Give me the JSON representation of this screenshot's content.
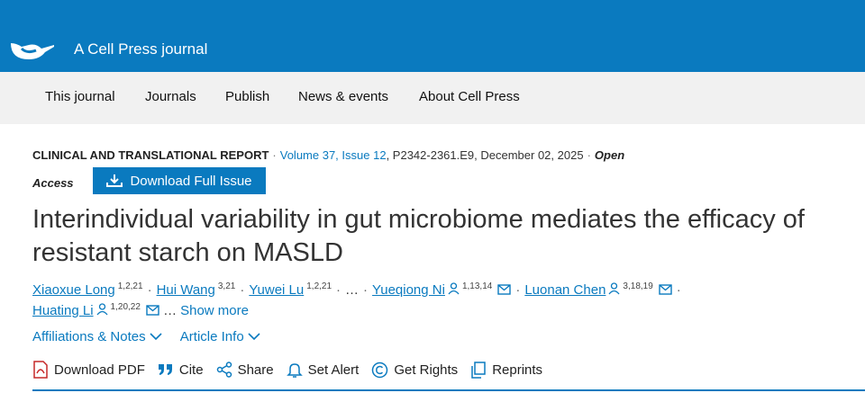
{
  "header": {
    "brand": "A Cell Press journal",
    "logo": "cell-press-logo-icon",
    "color": "#0a7abf"
  },
  "nav": [
    "This journal",
    "Journals",
    "Publish",
    "News & events",
    "About Cell Press"
  ],
  "article": {
    "type": "CLINICAL AND TRANSLATIONAL REPORT",
    "volume_issue": "Volume 37, Issue 12",
    "pages_date": "P2342-2361.E9, December 02, 2025",
    "open": "Open",
    "access": "Access",
    "download_issue": "Download Full Issue",
    "title": "Interindividual variability in gut microbiome mediates the efficacy of resistant starch on MASLD"
  },
  "authors": [
    {
      "name": "Xiaoxue Long",
      "sup": "1,2,21"
    },
    {
      "name": "Hui Wang",
      "sup": "3,21"
    },
    {
      "name": "Yuwei Lu",
      "sup": "1,2,21"
    },
    {
      "name": "Yueqiong Ni",
      "sup": "1,13,14"
    },
    {
      "name": "Luonan Chen",
      "sup": "3,18,19"
    },
    {
      "name": "Huating Li",
      "sup": "1,20,22"
    }
  ],
  "ellipsis": "…",
  "show_more": "Show more",
  "links": {
    "affiliations": "Affiliations & Notes",
    "article_info": "Article Info"
  },
  "actions": {
    "pdf": "Download PDF",
    "cite": "Cite",
    "share": "Share",
    "alert": "Set Alert",
    "rights": "Get Rights",
    "reprints": "Reprints"
  }
}
